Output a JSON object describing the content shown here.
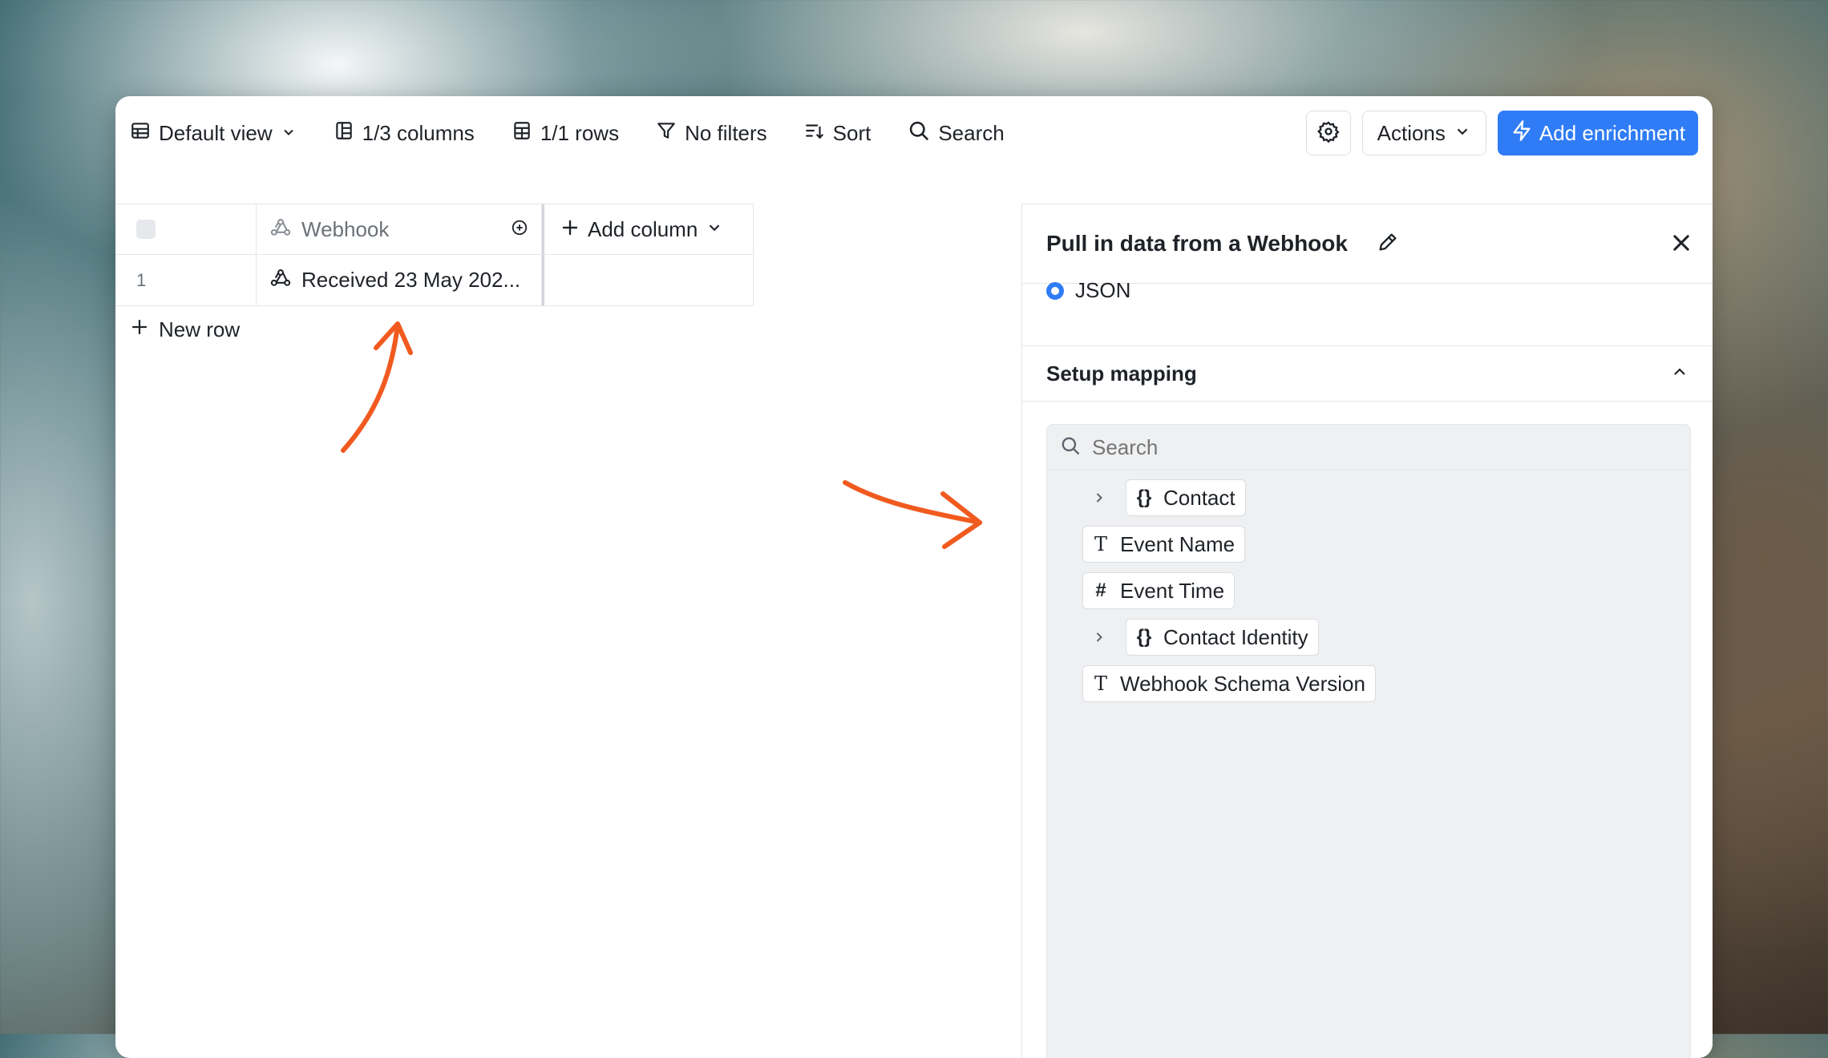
{
  "toolbar": {
    "view_label": "Default view",
    "columns_label": "1/3 columns",
    "rows_label": "1/1 rows",
    "filters_label": "No filters",
    "sort_label": "Sort",
    "search_label": "Search",
    "actions_label": "Actions",
    "enrich_label": "Add enrichment"
  },
  "table": {
    "column_header": "Webhook",
    "add_column_label": "Add column",
    "rows": [
      {
        "number": "1",
        "webhook_value": "Received 23 May 202..."
      }
    ],
    "new_row_label": "New row"
  },
  "panel": {
    "title": "Pull in data from a Webhook",
    "format_option": "JSON",
    "section_title": "Setup mapping",
    "search_placeholder": "Search",
    "fields": [
      {
        "label": "Contact",
        "type": "object",
        "icon": "braces-icon",
        "expandable": true
      },
      {
        "label": "Event Name",
        "type": "text",
        "icon": "text-T-icon",
        "expandable": false
      },
      {
        "label": "Event Time",
        "type": "number",
        "icon": "hash-icon",
        "expandable": false
      },
      {
        "label": "Contact Identity",
        "type": "object",
        "icon": "braces-icon",
        "expandable": true
      },
      {
        "label": "Webhook Schema Version",
        "type": "text",
        "icon": "text-T-icon",
        "expandable": false
      }
    ]
  },
  "colors": {
    "accent": "#2f7cf6",
    "annotation_arrow": "#f15a1f"
  }
}
